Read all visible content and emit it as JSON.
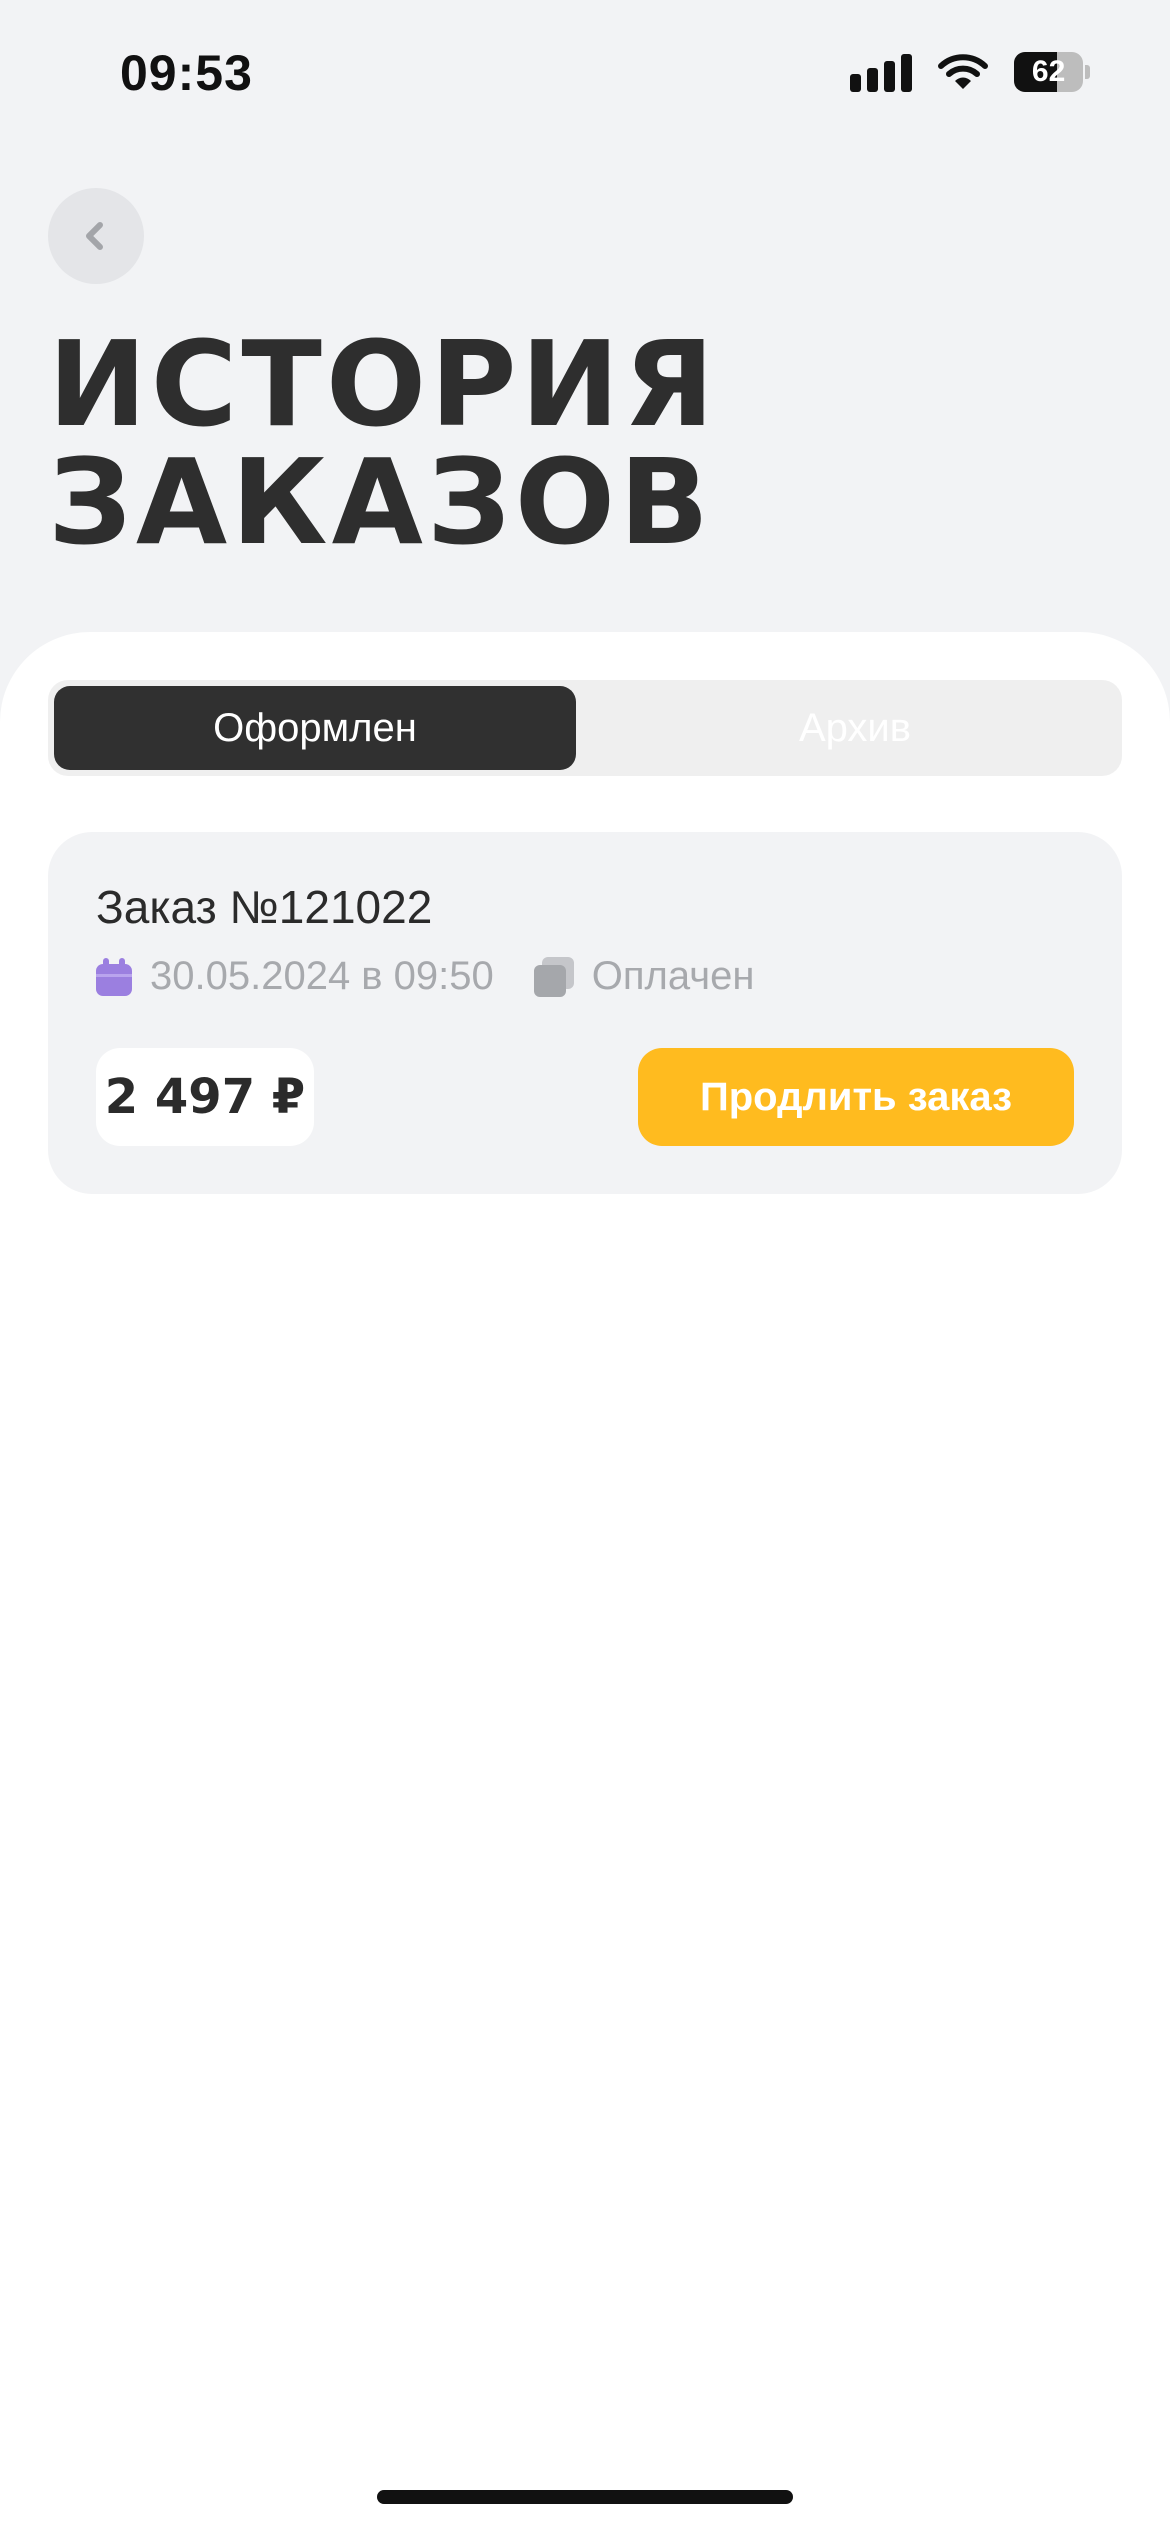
{
  "status_bar": {
    "time": "09:53",
    "battery_percent": "62",
    "battery_level": 0.62,
    "icons": [
      "signal-icon",
      "wifi-icon",
      "battery-icon"
    ]
  },
  "header": {
    "back_icon": "chevron-left-icon",
    "title_line1": "История",
    "title_line2": "заказов"
  },
  "tabs": [
    {
      "label": "Оформлен",
      "active": true
    },
    {
      "label": "Архив",
      "active": false
    }
  ],
  "orders": [
    {
      "title": "Заказ №121022",
      "date": "30.05.2024 в 09:50",
      "status": "Оплачен",
      "price": "2 497 ₽",
      "action_label": "Продлить заказ",
      "date_icon": "calendar-icon",
      "status_icon": "cards-icon"
    }
  ],
  "colors": {
    "background": "#f2f3f5",
    "accent": "#ffbb1f",
    "active_tab": "#303030",
    "calendar_icon": "#9b7fe0",
    "muted_text": "#a7a9ad"
  }
}
